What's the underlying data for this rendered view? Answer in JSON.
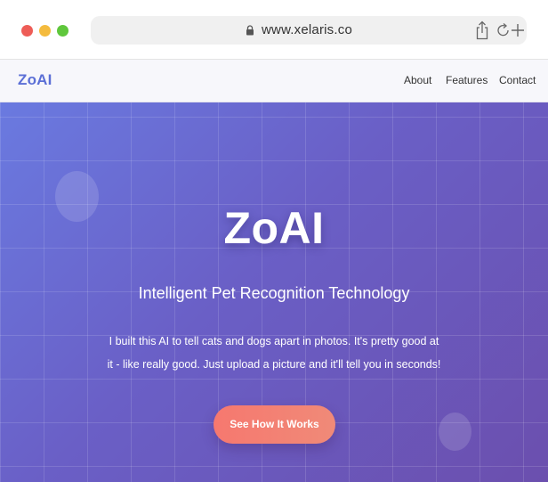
{
  "browser": {
    "url": "www.xelaris.co"
  },
  "nav": {
    "logo": "ZoAI",
    "links": [
      "About",
      "Features",
      "Contact"
    ]
  },
  "hero": {
    "title": "ZoAI",
    "subtitle": "Intelligent Pet Recognition Technology",
    "description": "I built this AI to tell cats and dogs apart in photos. It's pretty good at it - like really good. Just upload a picture and it'll tell you in seconds!",
    "cta_label": "See How It Works"
  },
  "colors": {
    "brand": "#5b6fd6",
    "hero_gradient_start": "#6a7ae0",
    "hero_gradient_end": "#6b4fae",
    "cta": "#f6786f"
  },
  "icons": [
    "lock-icon",
    "share-icon",
    "reload-icon",
    "plus-icon"
  ]
}
